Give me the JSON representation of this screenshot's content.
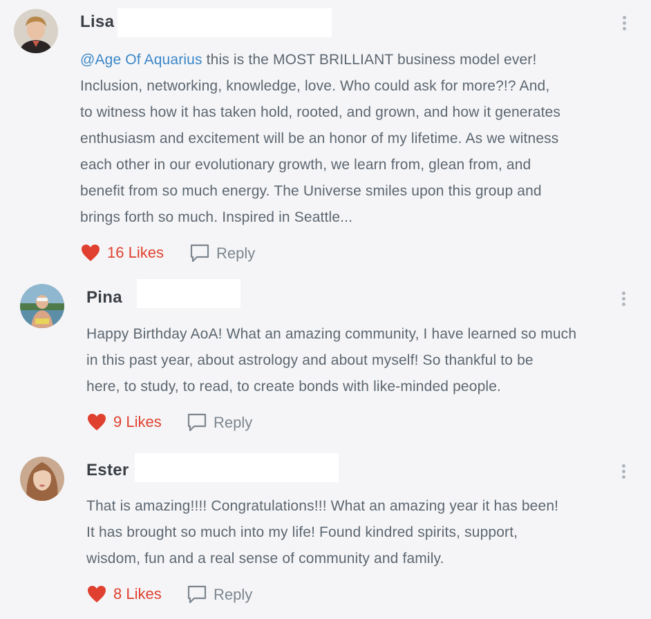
{
  "colors": {
    "background": "#f5f5f7",
    "text": "#5c6670",
    "name": "#3a3f45",
    "mention": "#3a86c8",
    "like": "#e0402f",
    "reply": "#7c858e"
  },
  "comments": [
    {
      "author": "Lisa",
      "mention": "@Age Of Aquarius",
      "lines": [
        " this is the MOST BRILLIANT business model ever!",
        "Inclusion, networking, knowledge, love.  Who could ask for more?!?  And,",
        "to witness how it has taken hold, rooted, and grown, and how it generates",
        "enthusiasm and excitement will be an honor of my lifetime.  As we witness",
        "each other in our evolutionary growth, we learn from, glean from, and",
        "benefit from so much energy.  The Universe smiles upon this group and",
        "brings forth so much.    Inspired in Seattle..."
      ],
      "likes": "16 Likes",
      "reply": "Reply",
      "avatar_icon": "avatar-photo"
    },
    {
      "author": "Pina",
      "lines": [
        "Happy Birthday AoA! What an amazing community, I have learned so much",
        "in this past year, about astrology and about myself! So thankful to be",
        "here, to study, to read, to create bonds with like-minded people."
      ],
      "likes": "9 Likes",
      "reply": "Reply",
      "avatar_icon": "avatar-photo"
    },
    {
      "author": "Ester",
      "lines": [
        "That is amazing!!!! Congratulations!!! What an amazing year it has been!",
        "It has brought so much into my life! Found kindred spirits, support,",
        "wisdom, fun and a real sense of community and family."
      ],
      "likes": "8 Likes",
      "reply": "Reply",
      "avatar_icon": "avatar-photo"
    }
  ]
}
